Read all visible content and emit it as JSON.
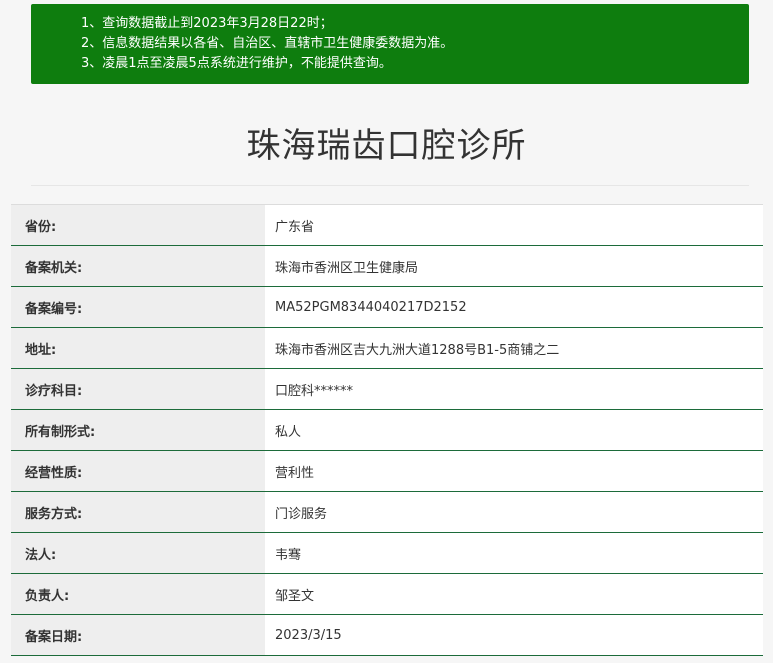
{
  "notice": {
    "lines": [
      "1、查询数据截止到2023年3月28日22时；",
      "2、信息数据结果以各省、自治区、直辖市卫生健康委数据为准。",
      "3、凌晨1点至凌晨5点系统进行维护，不能提供查询。"
    ]
  },
  "title": "珠海瑞齿口腔诊所",
  "records": [
    {
      "label": "省份:",
      "value": "广东省"
    },
    {
      "label": "备案机关:",
      "value": "珠海市香洲区卫生健康局"
    },
    {
      "label": "备案编号:",
      "value": "MA52PGM8344040217D2152"
    },
    {
      "label": "地址:",
      "value": "珠海市香洲区吉大九洲大道1288号B1-5商铺之二"
    },
    {
      "label": "诊疗科目:",
      "value": "口腔科******"
    },
    {
      "label": "所有制形式:",
      "value": "私人"
    },
    {
      "label": "经营性质:",
      "value": "营利性"
    },
    {
      "label": "服务方式:",
      "value": "门诊服务"
    },
    {
      "label": "法人:",
      "value": "韦骞"
    },
    {
      "label": "负责人:",
      "value": "邹圣文"
    },
    {
      "label": "备案日期:",
      "value": "2023/3/15"
    }
  ]
}
